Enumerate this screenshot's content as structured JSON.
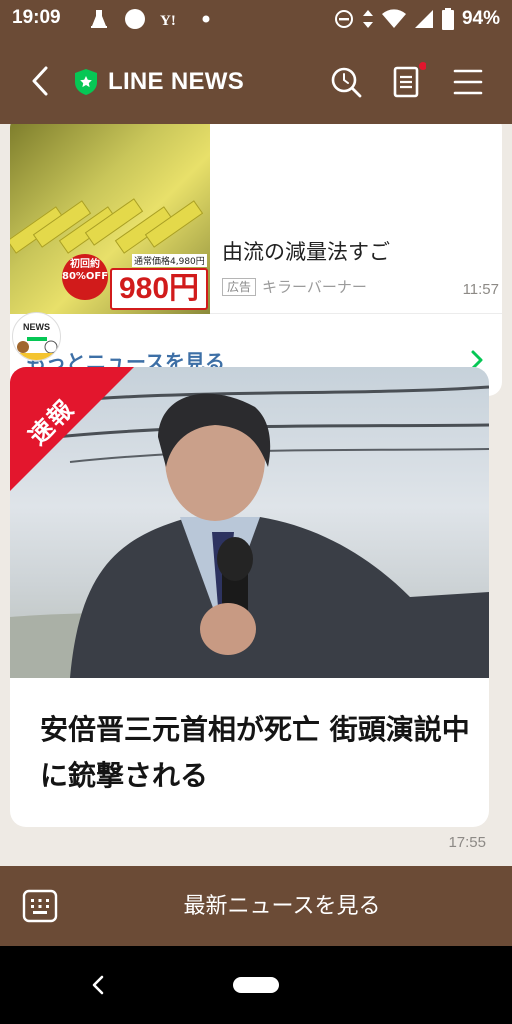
{
  "status_bar": {
    "time": "19:09",
    "battery": "94%",
    "icons_left": [
      "cleaning-icon",
      "circle-icon",
      "yahoo-icon",
      "dot-icon"
    ],
    "icons_right": [
      "dnd-icon",
      "data-icon",
      "wifi-icon",
      "signal-icon",
      "battery-icon"
    ]
  },
  "header": {
    "title": "LINE NEWS",
    "accent_color": "#06c755",
    "background_color": "#6b4b36"
  },
  "ad_card": {
    "title": "由流の減量法すご",
    "label": "広告",
    "sponsor": "キラーバーナー",
    "badge_text": "初回約80%OFF",
    "normal_price": "通常価格4,980円",
    "price": "980円",
    "more_news": "もっとニュースを見る"
  },
  "timestamps": {
    "first": "11:57",
    "second": "17:55"
  },
  "news_card": {
    "avatar_label": "NEWS",
    "flash_label": "速報",
    "flash_color": "#e3162d",
    "headline": "安倍晋三元首相が死亡 街頭演説中に銃撃される"
  },
  "bottom_bar": {
    "latest_news": "最新ニュースを見る"
  }
}
